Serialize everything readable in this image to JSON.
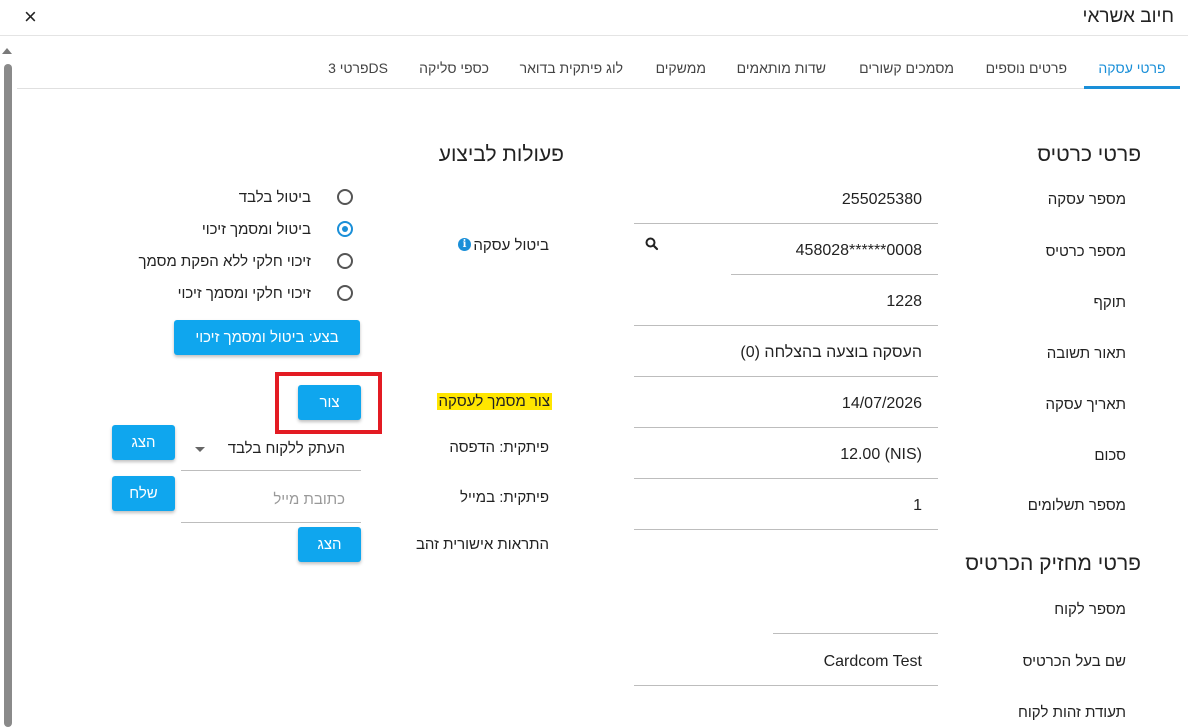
{
  "window": {
    "title": "חיוב אשראי",
    "close": "×"
  },
  "tabs": [
    {
      "label": "פרטי עסקה"
    },
    {
      "label": "פרטים נוספים"
    },
    {
      "label": "מסמכים קשורים"
    },
    {
      "label": "שדות מותאמים"
    },
    {
      "label": "ממשקים"
    },
    {
      "label": "לוג פיתקית בדואר"
    },
    {
      "label": "כספי סליקה"
    },
    {
      "label": "פרטי 3DS"
    }
  ],
  "card_details": {
    "title": "פרטי כרטיס",
    "fields": [
      {
        "label": "מספר עסקה",
        "value": "255025380"
      },
      {
        "label": "מספר כרטיס",
        "value": "458028******0008"
      },
      {
        "label": "תוקף",
        "value": "1228"
      },
      {
        "label": "תאור תשובה",
        "value": "העסקה בוצעה בהצלחה (0)"
      },
      {
        "label": "תאריך עסקה",
        "value": "14/07/2026"
      },
      {
        "label": "סכום",
        "value": "12.00 (NIS)"
      },
      {
        "label": "מספר תשלומים",
        "value": "1"
      }
    ]
  },
  "holder_details": {
    "title": "פרטי מחזיק הכרטיס",
    "fields": [
      {
        "label": "מספר לקוח",
        "value": ""
      },
      {
        "label": "שם בעל הכרטיס",
        "value": "Cardcom Test"
      },
      {
        "label": "תעודת זהות לקוח",
        "value": ""
      }
    ]
  },
  "actions": {
    "title": "פעולות לביצוע",
    "cancel_label": "ביטול עסקה",
    "info_glyph": "i",
    "radio_options": [
      {
        "label": "ביטול בלבד",
        "checked": false
      },
      {
        "label": "ביטול ומסמך זיכוי",
        "checked": true
      },
      {
        "label": "זיכוי חלקי ללא הפקת מסמך",
        "checked": false
      },
      {
        "label": "זיכוי חלקי ומסמך זיכוי",
        "checked": false
      }
    ],
    "execute_button": "בצע: ביטול ומסמך זיכוי",
    "create_doc_label": "צור מסמך לעסקה",
    "create_button": "צור",
    "print_label": "פיתקית: הדפסה",
    "print_select_value": "העתק ללקוח בלבד",
    "print_show_button": "הצג",
    "email_label": "פיתקית: במייל",
    "email_placeholder": "כתובת מייל",
    "email_send_button": "שלח",
    "gold_label": "התראות אישורית זהב",
    "gold_show_button": "הצג"
  },
  "colors": {
    "accent": "#1a8fd8",
    "button": "#0fa6ee",
    "highlight": "#ffe600",
    "annotation_box": "#e31b23"
  }
}
